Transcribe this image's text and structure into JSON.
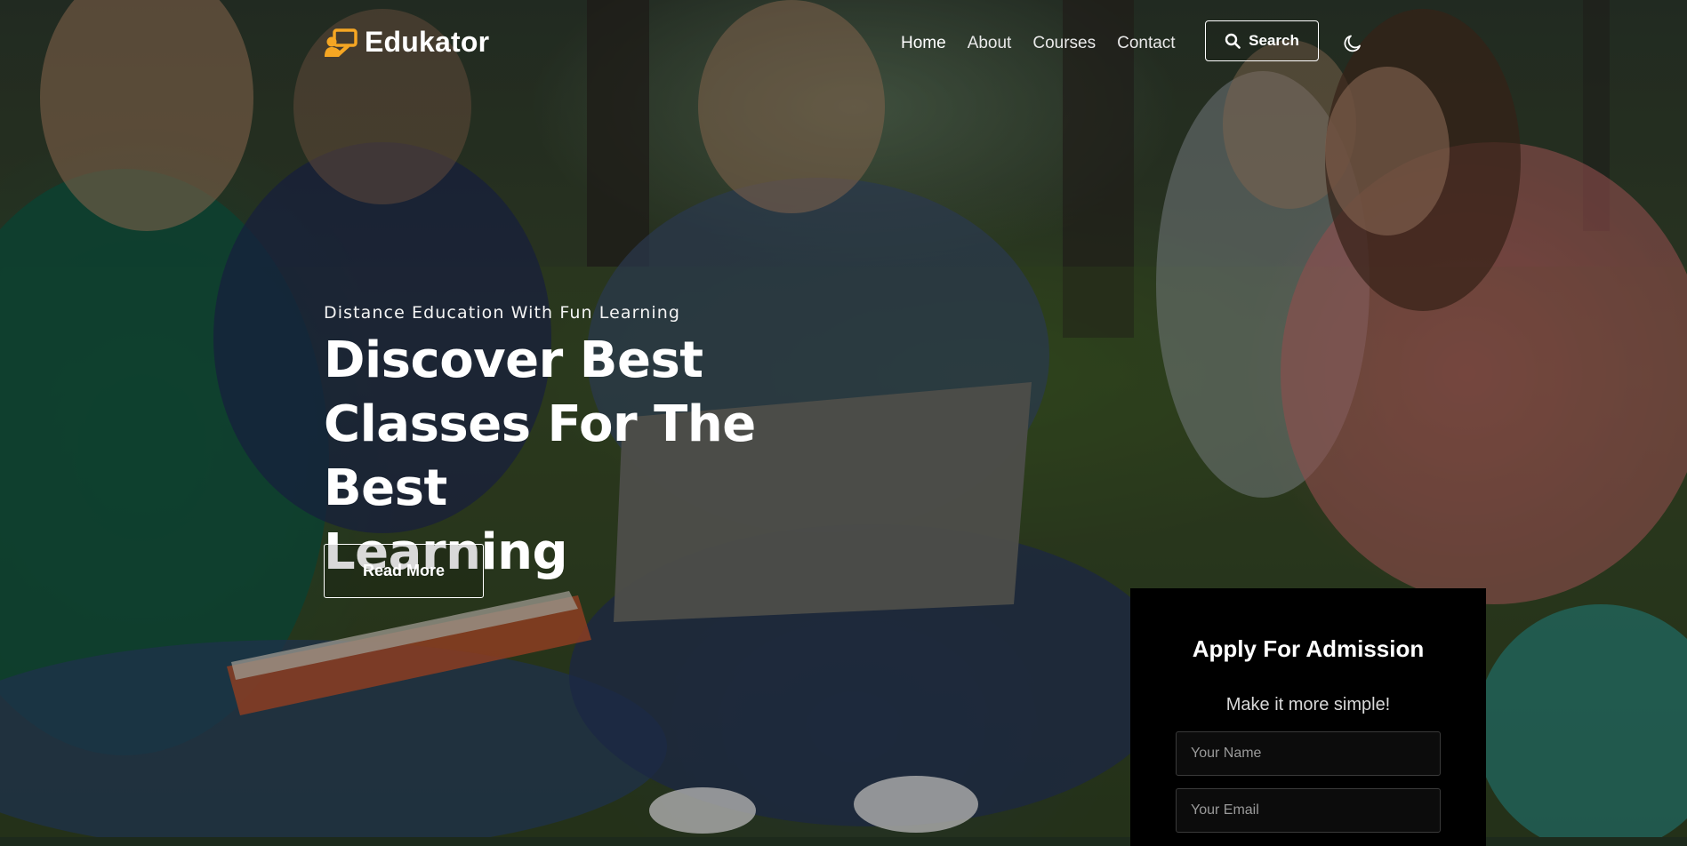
{
  "brand": {
    "name": "Edukator",
    "icon": "teacher-board-icon",
    "accent": "#f5a623"
  },
  "nav": {
    "links": [
      {
        "label": "Home",
        "active": true
      },
      {
        "label": "About",
        "active": false
      },
      {
        "label": "Courses",
        "active": false
      },
      {
        "label": "Contact",
        "active": false
      }
    ],
    "search_label": "Search",
    "search_icon": "search-icon",
    "theme_icon": "moon-icon"
  },
  "hero": {
    "tagline": "Distance Education With Fun Learning",
    "title_lines": [
      "Discover Best",
      "Classes For The Best",
      "Learning"
    ],
    "cta_label": "Read More",
    "background": "photo of students studying outdoors with a laptop"
  },
  "admission": {
    "title": "Apply For Admission",
    "subtitle": "Make it more simple!",
    "name_placeholder": "Your Name",
    "email_placeholder": "Your Email"
  }
}
